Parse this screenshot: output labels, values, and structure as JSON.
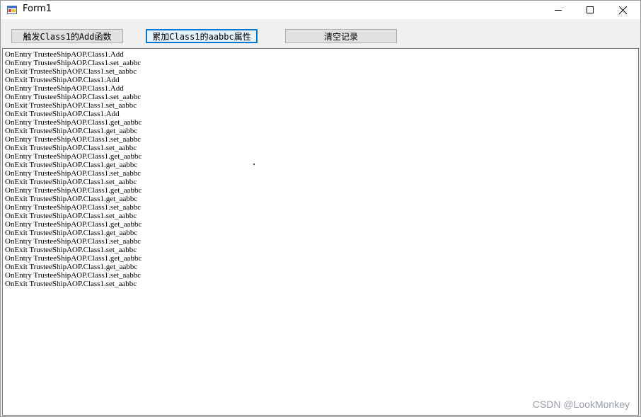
{
  "window": {
    "title": "Form1",
    "icon": "winforms-app-icon",
    "controls": {
      "minimize": "minimize-icon",
      "maximize": "maximize-icon",
      "close": "close-icon"
    }
  },
  "toolbar": {
    "trigger_add_label": "触发Class1的Add函数",
    "accumulate_label": "累加Class1的aabbc属性",
    "clear_label": "清空记录"
  },
  "log": {
    "lines": [
      "OnEntry TrusteeShipAOP.Class1.Add",
      "OnEntry TrusteeShipAOP.Class1.set_aabbc",
      "OnExit TrusteeShipAOP.Class1.set_aabbc",
      "OnExit TrusteeShipAOP.Class1.Add",
      "OnEntry TrusteeShipAOP.Class1.Add",
      "OnEntry TrusteeShipAOP.Class1.set_aabbc",
      "OnExit TrusteeShipAOP.Class1.set_aabbc",
      "OnExit TrusteeShipAOP.Class1.Add",
      "OnEntry TrusteeShipAOP.Class1.get_aabbc",
      "OnExit TrusteeShipAOP.Class1.get_aabbc",
      "OnEntry TrusteeShipAOP.Class1.set_aabbc",
      "OnExit TrusteeShipAOP.Class1.set_aabbc",
      "OnEntry TrusteeShipAOP.Class1.get_aabbc",
      "OnExit TrusteeShipAOP.Class1.get_aabbc",
      "OnEntry TrusteeShipAOP.Class1.set_aabbc",
      "OnExit TrusteeShipAOP.Class1.set_aabbc",
      "OnEntry TrusteeShipAOP.Class1.get_aabbc",
      "OnExit TrusteeShipAOP.Class1.get_aabbc",
      "OnEntry TrusteeShipAOP.Class1.set_aabbc",
      "OnExit TrusteeShipAOP.Class1.set_aabbc",
      "OnEntry TrusteeShipAOP.Class1.get_aabbc",
      "OnExit TrusteeShipAOP.Class1.get_aabbc",
      "OnEntry TrusteeShipAOP.Class1.set_aabbc",
      "OnExit TrusteeShipAOP.Class1.set_aabbc",
      "OnEntry TrusteeShipAOP.Class1.get_aabbc",
      "OnExit TrusteeShipAOP.Class1.get_aabbc",
      "OnEntry TrusteeShipAOP.Class1.set_aabbc",
      "OnExit TrusteeShipAOP.Class1.set_aabbc"
    ]
  },
  "watermark": "CSDN @LookMonkey",
  "colors": {
    "focus_border": "#0078d7",
    "button_face": "#e1e1e1",
    "window_bg": "#f0f0f0"
  }
}
